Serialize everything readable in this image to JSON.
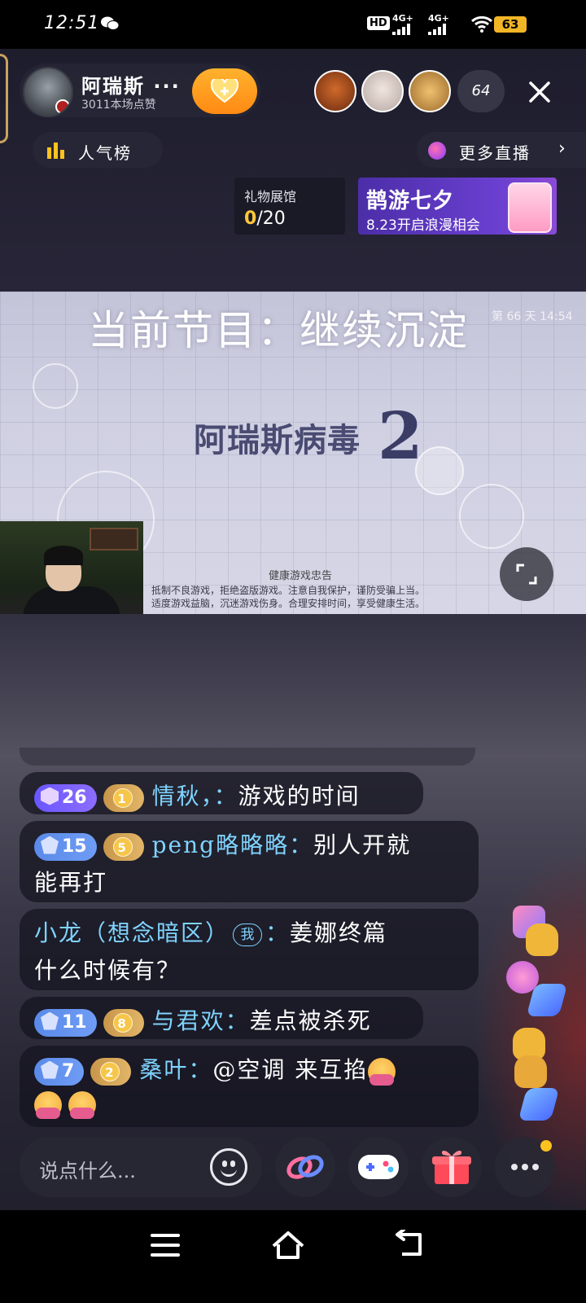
{
  "status_bar": {
    "time": "12:51",
    "hd_label": "HD",
    "network_1": "4G+",
    "network_2": "4G+",
    "battery": "63",
    "icons": [
      "wechat-icon",
      "hd-icon",
      "signal-icon",
      "signal-icon",
      "wifi-icon",
      "battery-icon"
    ]
  },
  "header": {
    "host_name": "阿瑞斯 ···",
    "host_subtitle": "3011本场点赞",
    "viewer_count": "64",
    "rank_label": "人气榜",
    "more_live_label": "更多直播",
    "accent_color": "#ff9a1e"
  },
  "gift_hall": {
    "title": "礼物展馆",
    "current": "0",
    "total": "/20"
  },
  "banner": {
    "title": "鹊游七夕",
    "subtitle": "8.23开启浪漫相会"
  },
  "video": {
    "program": "当前节目：继续沉淀",
    "day_time": "第 66 天  14:54",
    "game_title": "阿瑞斯病毒",
    "game_number": "2",
    "notice_title": "健康游戏忠告",
    "notice_line1": "抵制不良游戏，拒绝盗版游戏。注意自我保护，谨防受骗上当。",
    "notice_line2": "适度游戏益脑，沉迷游戏伤身。合理安排时间，享受健康生活。"
  },
  "chat": {
    "messages": [
      {
        "level": "26",
        "fan_level": "1",
        "name": "情秋，",
        "sep": "：",
        "text": "游戏的时间"
      },
      {
        "level": "15",
        "fan_level": "5",
        "name": "peng略略略",
        "sep": "：",
        "text": "别人开就",
        "text2": "能再打"
      },
      {
        "name": "小龙（想念暗区）",
        "me_tag": "我",
        "sep": "：",
        "text": "姜娜终篇",
        "text2": "什么时候有？"
      },
      {
        "level": "11",
        "fan_level": "8",
        "name": "与君欢",
        "sep": "：",
        "text": "差点被杀死"
      },
      {
        "level": "7",
        "fan_level": "2",
        "name": "桑叶",
        "sep": "：",
        "text": "@空调 来互掐"
      }
    ]
  },
  "bottom_bar": {
    "input_placeholder": "说点什么...",
    "icons": [
      "emoji-icon",
      "link-icon",
      "gamepad-icon",
      "gift-icon",
      "more-icon"
    ]
  },
  "nav_bar": {
    "icons": [
      "menu-icon",
      "home-icon",
      "back-icon"
    ]
  }
}
